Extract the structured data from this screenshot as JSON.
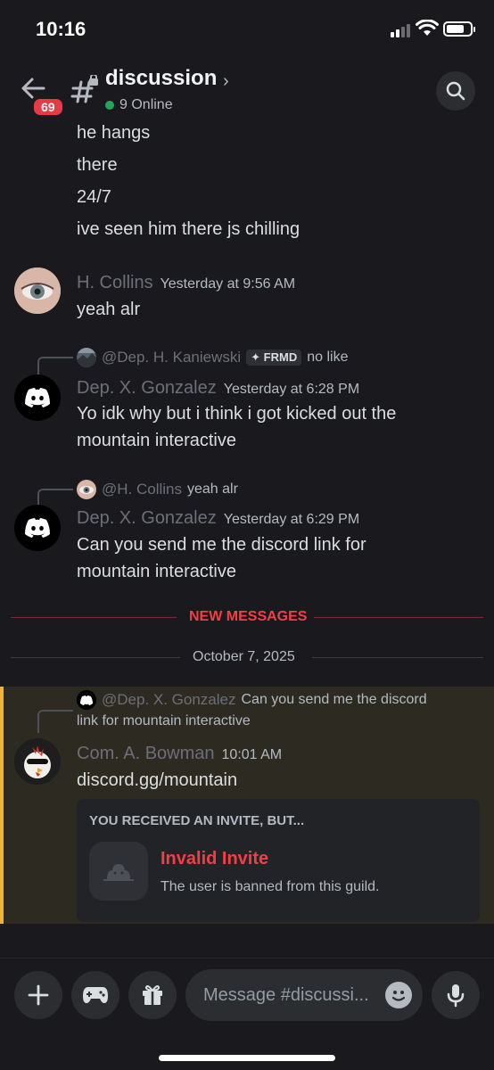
{
  "status_bar": {
    "time": "10:16"
  },
  "header": {
    "back_badge": "69",
    "channel_name": "discussion",
    "chevron": "›",
    "online_text": "9 Online",
    "icons": [
      "back-arrow-icon",
      "locked-channel-hash-icon",
      "search-icon"
    ]
  },
  "messages": {
    "continued_lines": [
      "he hangs",
      "there",
      "24/7",
      "ive seen him there js chilling"
    ],
    "msg1": {
      "username": "H. Collins",
      "timestamp": "Yesterday at 9:56 AM",
      "text": "yeah alr"
    },
    "msg2": {
      "reply_to": "@Dep. H. Kaniewski",
      "reply_tag": "FRMD",
      "reply_text": "no like",
      "username": "Dep. X. Gonzalez",
      "timestamp": "Yesterday at 6:28 PM",
      "text_line1": "Yo idk why but i think i got kicked out the",
      "text_line2": "mountain interactive"
    },
    "msg3": {
      "reply_to": "@H. Collins",
      "reply_text": "yeah alr",
      "username": "Dep. X. Gonzalez",
      "timestamp": "Yesterday at 6:29 PM",
      "text_line1": "Can you send me the discord link for",
      "text_line2": "mountain interactive"
    },
    "new_messages_label": "NEW MESSAGES",
    "date_divider": "October 7, 2025",
    "msg4": {
      "reply_to": "@Dep. X. Gonzalez",
      "reply_text_line1": "Can you send me the discord",
      "reply_text_line2": "link for mountain interactive",
      "username": "Com. A. Bowman",
      "timestamp": "10:01 AM",
      "text": "discord.gg/mountain",
      "invite": {
        "header": "YOU RECEIVED AN INVITE, BUT...",
        "title": "Invalid Invite",
        "subtitle": "The user is banned from this guild."
      }
    }
  },
  "input": {
    "placeholder": "Message #discussi...",
    "buttons": [
      "plus-icon",
      "gamepad-icon",
      "gift-icon",
      "emoji-icon",
      "microphone-icon"
    ]
  },
  "colors": {
    "background": "#1a1a1e",
    "badge_red": "#e43b44",
    "online_green": "#23a55a",
    "new_messages_red": "#f23f43",
    "highlight_yellow": "#f0b232"
  }
}
